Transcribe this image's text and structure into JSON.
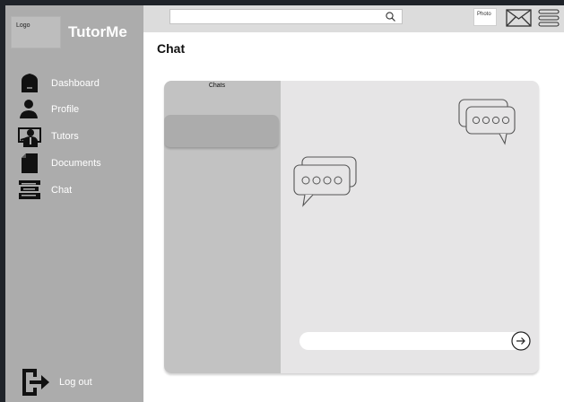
{
  "sidebar": {
    "logo_text": "Logo",
    "brand": "TutorMe",
    "items": [
      {
        "label": "Dashboard",
        "icon": "home-icon"
      },
      {
        "label": "Profile",
        "icon": "person-icon"
      },
      {
        "label": "Tutors",
        "icon": "tutor-icon"
      },
      {
        "label": "Documents",
        "icon": "document-icon"
      },
      {
        "label": "Chat",
        "icon": "books-icon"
      }
    ],
    "logout_label": "Log out"
  },
  "topbar": {
    "search_placeholder": "",
    "photo_label": "Photo"
  },
  "page": {
    "title": "Chat"
  },
  "chat": {
    "list_title": "Chats",
    "message_placeholder": ""
  }
}
